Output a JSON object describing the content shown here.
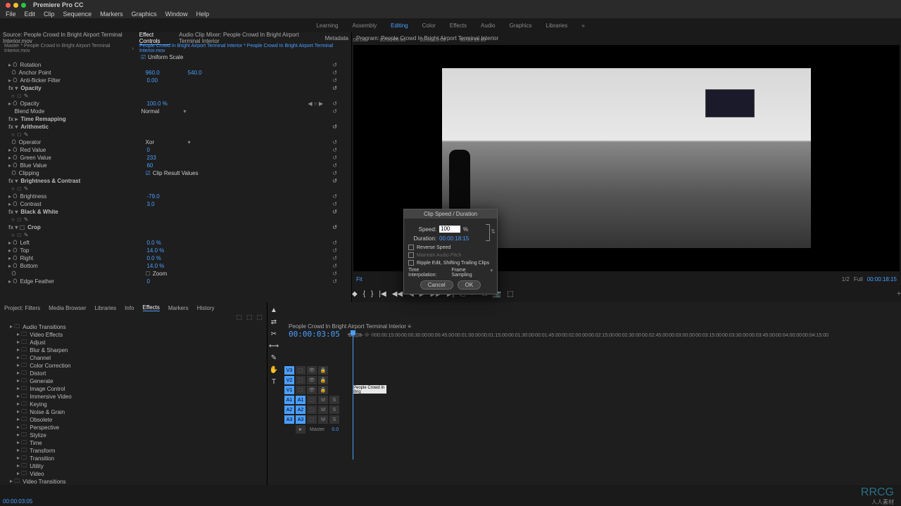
{
  "mac": {
    "app": "Premiere Pro CC"
  },
  "menu": [
    "File",
    "Edit",
    "Clip",
    "Sequence",
    "Markers",
    "Graphics",
    "Window",
    "Help"
  ],
  "workspaces": {
    "items": [
      "Learning",
      "Assembly",
      "Editing",
      "Color",
      "Effects",
      "Audio",
      "Graphics",
      "Libraries"
    ],
    "active": "Editing",
    "arrow": "»"
  },
  "source_pane": {
    "tabs": [
      "Source: People Crowd In Bright Airport Terminal Interior.mov",
      "Effect Controls",
      "Audio Clip Mixer: People Crowd In Bright Airport Terminal Interior",
      "Metadata"
    ],
    "active": "Effect Controls",
    "master_line": "Master * People Crowd In Bright Airport Terminal Interior.mov",
    "clip_line": "People Crowd In Bright Airport Terminal Interior * People Crowd In Bright Airport Terminal Interior.mov",
    "uniform": "Uniform Scale",
    "rows": [
      {
        "name": "Rotation",
        "val": ""
      },
      {
        "name": "Anchor Point",
        "val": "960.0",
        "val2": "540.0"
      },
      {
        "name": "Anti-flicker Filter",
        "val": "0.00"
      },
      {
        "group": true,
        "name": "Opacity"
      },
      {
        "icons": true
      },
      {
        "name": "Opacity",
        "val": "100.0 %",
        "kf": true
      },
      {
        "name": "Blend Mode",
        "val": "Normal",
        "dropdown": true
      },
      {
        "group": true,
        "name": "Time Remapping"
      },
      {
        "group": true,
        "name": "Arithmetic"
      },
      {
        "icons": true
      },
      {
        "name": "Operator",
        "val": "Xor",
        "dropdown": true
      },
      {
        "name": "Red Value",
        "val": "0"
      },
      {
        "name": "Green Value",
        "val": "233"
      },
      {
        "name": "Blue Value",
        "val": "60"
      },
      {
        "name": "Clipping",
        "chk": true,
        "chklabel": "Clip Result Values"
      },
      {
        "group": true,
        "name": "Brightness & Contrast"
      },
      {
        "icons": true
      },
      {
        "name": "Brightness",
        "val": "-79.0"
      },
      {
        "name": "Contrast",
        "val": "3.0"
      },
      {
        "group": true,
        "name": "Black & White"
      },
      {
        "icons": true
      },
      {
        "group": true,
        "name": "Crop"
      },
      {
        "icons": true
      },
      {
        "name": "Left",
        "val": "0.0 %"
      },
      {
        "name": "Top",
        "val": "14.0 %"
      },
      {
        "name": "Right",
        "val": "0.0 %"
      },
      {
        "name": "Bottom",
        "val": "14.0 %"
      },
      {
        "name": "",
        "chk": true,
        "chklabel": "Zoom"
      },
      {
        "name": "Edge Feather",
        "val": "0"
      }
    ],
    "ruler": [
      ":00:00",
      "00:00:05:00",
      "00:00:10:00",
      "00:00:15:00"
    ],
    "src_timecode": "00:00:03:05"
  },
  "program": {
    "title": "Program: People Crowd In Bright Airport Terminal Interior",
    "fit": "Fit",
    "half": "1/2",
    "full": "Full",
    "timecode": "00:00:18:15"
  },
  "transport": [
    "◆",
    "{",
    "}",
    "|◀",
    "◀◀",
    "◀",
    "▶",
    "▶▶",
    "▶|",
    "⎘",
    "✂",
    "□",
    "📷",
    "⬚"
  ],
  "project": {
    "tabs": [
      "Project: Filters",
      "Media Browser",
      "Libraries",
      "Info",
      "Effects",
      "Markers",
      "History"
    ],
    "active": "Effects",
    "folders": [
      "Audio Transitions",
      "Video Effects",
      "Adjust",
      "Blur & Sharpen",
      "Channel",
      "Color Correction",
      "Distort",
      "Generate",
      "Image Control",
      "Immersive Video",
      "Keying",
      "Noise & Grain",
      "Obsolete",
      "Perspective",
      "Stylize",
      "Time",
      "Transform",
      "Transition",
      "Utility",
      "Video",
      "Video Transitions"
    ]
  },
  "timeline": {
    "title": "People Crowd In Bright Airport Terminal Interior",
    "timecode": "00:00:03:05",
    "ruler": [
      ":00:00",
      "00:00:15:00",
      "00:00:30:00",
      "00:00:45:00",
      "00:01:00:00",
      "00:01:15:00",
      "00:01:30:00",
      "00:01:45:00",
      "00:02:00:00",
      "00:02:15:00",
      "00:02:30:00",
      "00:02:45:00",
      "00:03:00:00",
      "00:03:15:00",
      "00:03:30:00",
      "00:03:45:00",
      "00:04:00:00",
      "00:04:15:00"
    ],
    "tracks_v": [
      "V3",
      "V2",
      "V1"
    ],
    "tracks_a": [
      "A1",
      "A2",
      "A3"
    ],
    "master": "Master",
    "master_val": "0.0",
    "clip_name": "People Crowd In Brig"
  },
  "tools": [
    "▲",
    "⇄",
    "✂",
    "⟷",
    "✎",
    "✋",
    "T"
  ],
  "dialog": {
    "title": "Clip Speed / Duration",
    "speed_label": "Speed:",
    "speed_val": "100",
    "speed_pct": "%",
    "speed_unit": "%",
    "duration_label": "Duration:",
    "duration_val": "00:00:18:15",
    "reverse": "Reverse Speed",
    "pitch": "Maintain Audio Pitch",
    "ripple": "Ripple Edit, Shifting Trailing Clips",
    "interp_label": "Time Interpolation:",
    "interp_val": "Frame Sampling",
    "cancel": "Cancel",
    "ok": "OK"
  },
  "watermark": "RRCG",
  "watermark_sub": "人人素材"
}
